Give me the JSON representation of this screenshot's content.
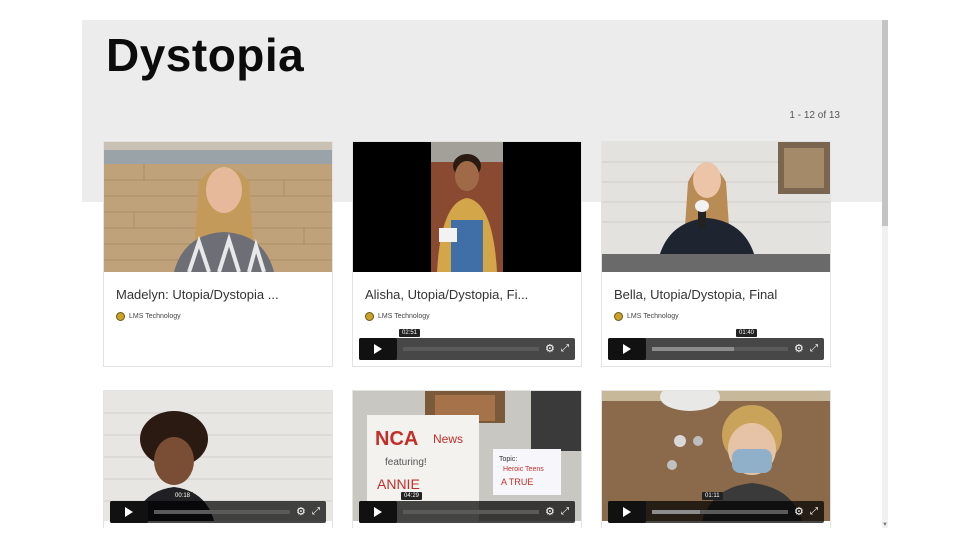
{
  "page": {
    "title": "Dystopia",
    "pagination": "1 - 12 of 13"
  },
  "videos": [
    {
      "title": "Madelyn: Utopia/Dystopia ...",
      "author": "LMS Technology",
      "duration": "",
      "progress": 0
    },
    {
      "title": "Alisha, Utopia/Dystopia, Fi...",
      "author": "LMS Technology",
      "duration": "02:51",
      "progress": 0
    },
    {
      "title": "Bella, Utopia/Dystopia, Final",
      "author": "LMS Technology",
      "duration": "01:40",
      "progress": 0.6
    },
    {
      "title": "",
      "author": "",
      "duration": "00:18",
      "progress": 0
    },
    {
      "title": "",
      "author": "",
      "duration": "04:29",
      "progress": 0
    },
    {
      "title": "",
      "author": "",
      "duration": "01:11",
      "progress": 0.35
    }
  ],
  "thumbnail_text": {
    "sign_left_1": "NCA",
    "sign_left_2": "News",
    "sign_left_3": "featuring!",
    "sign_left_4": "ANNIE",
    "sign_right_1": "Topic:",
    "sign_right_2": "Heroic Teens",
    "sign_right_3": "A TRUE"
  },
  "icons": {
    "play": "play-icon",
    "settings": "gear-icon",
    "fullscreen": "expand-icon",
    "author": "author-avatar-icon"
  },
  "colors": {
    "header_band": "#ececec",
    "title": "#0c0c0c",
    "author_dot": "#c9a227",
    "player_bar": "#111111"
  }
}
